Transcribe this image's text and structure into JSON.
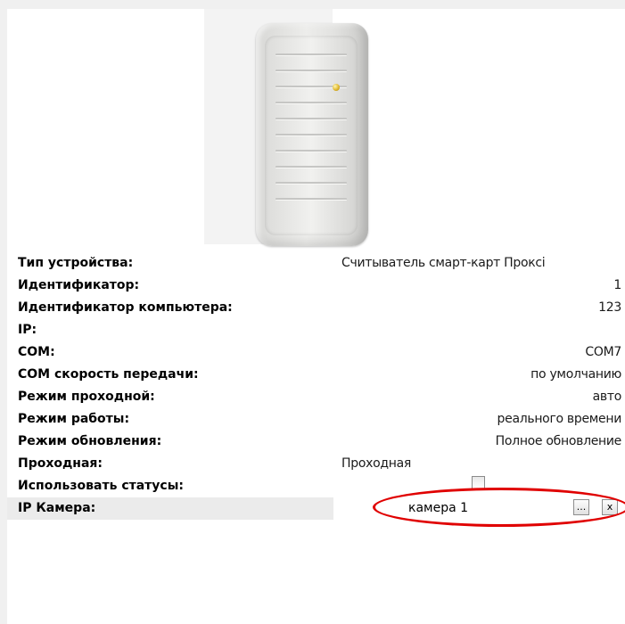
{
  "properties": {
    "device_type": {
      "label": "Тип устройства:",
      "value": "Считыватель смарт-карт Проксі"
    },
    "identifier": {
      "label": "Идентификатор:",
      "value": "1"
    },
    "computer_id": {
      "label": "Идентификатор компьютера:",
      "value": "123"
    },
    "ip": {
      "label": "IP:",
      "value": ""
    },
    "com": {
      "label": "COM:",
      "value": "COM7"
    },
    "com_speed": {
      "label": "COM скорость передачи:",
      "value": "по умолчанию"
    },
    "passage_mode": {
      "label": "Режим проходной:",
      "value": "авто"
    },
    "work_mode": {
      "label": "Режим работы:",
      "value": "реального времени"
    },
    "update_mode": {
      "label": "Режим обновления:",
      "value": "Полное обновление"
    },
    "passage": {
      "label": "Проходная:",
      "value": "Проходная"
    },
    "use_statuses": {
      "label": "Использовать статусы:",
      "checked": false
    },
    "ip_camera": {
      "label": "IP Камера:",
      "value": "камера 1",
      "browse_label": "...",
      "clear_label": "x"
    }
  }
}
